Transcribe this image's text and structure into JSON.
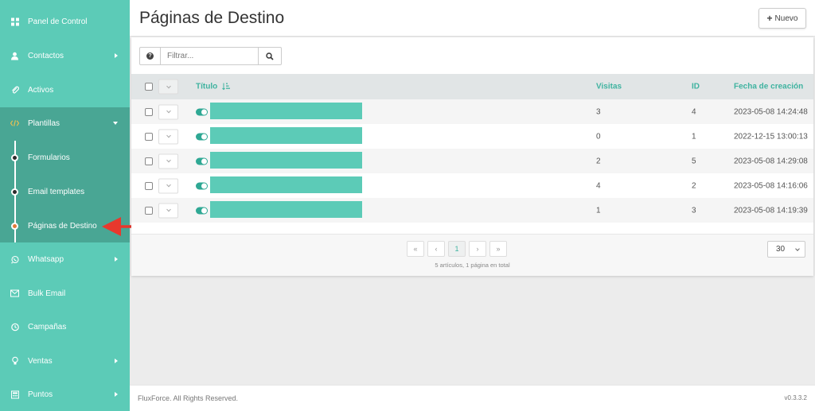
{
  "sidebar": {
    "items": [
      {
        "label": "Panel de Control",
        "icon": "dashboard-icon"
      },
      {
        "label": "Contactos",
        "icon": "user-icon"
      },
      {
        "label": "Activos",
        "icon": "paperclip-icon"
      },
      {
        "label": "Plantillas",
        "icon": "code-icon"
      },
      {
        "label": "Whatsapp",
        "icon": "whatsapp-icon"
      },
      {
        "label": "Bulk Email",
        "icon": "envelope-icon"
      },
      {
        "label": "Campañas",
        "icon": "clock-icon"
      },
      {
        "label": "Ventas",
        "icon": "lightbulb-icon"
      },
      {
        "label": "Puntos",
        "icon": "calculator-icon"
      }
    ],
    "submenu": [
      {
        "label": "Formularios"
      },
      {
        "label": "Email templates"
      },
      {
        "label": "Páginas de Destino"
      }
    ],
    "colors": {
      "bg": "#5ccbb7",
      "submenu_bg": "#49a694",
      "active_dot": "#e07a3a"
    }
  },
  "header": {
    "title": "Páginas de Destino",
    "new_button": "Nuevo"
  },
  "filter": {
    "placeholder": "Filtrar..."
  },
  "table": {
    "columns": {
      "title": "Título",
      "visits": "Visitas",
      "id": "ID",
      "created": "Fecha de creación"
    },
    "rows": [
      {
        "visits": "3",
        "id": "4",
        "created": "2023-05-08 14:24:48"
      },
      {
        "visits": "0",
        "id": "1",
        "created": "2022-12-15 13:00:13"
      },
      {
        "visits": "2",
        "id": "5",
        "created": "2023-05-08 14:29:08"
      },
      {
        "visits": "4",
        "id": "2",
        "created": "2023-05-08 14:16:06"
      },
      {
        "visits": "1",
        "id": "3",
        "created": "2023-05-08 14:19:39"
      }
    ]
  },
  "pagination": {
    "current_page": "1",
    "info": "5 artículos, 1 página en total",
    "per_page": "30"
  },
  "footer": {
    "copyright": "FluxForce. All Rights Reserved.",
    "version": "v0.3.3.2"
  },
  "colors": {
    "accent": "#5ccbb7",
    "header_text": "#3fb3a0",
    "toggle": "#2fa894",
    "annotation": "#e8382d"
  }
}
